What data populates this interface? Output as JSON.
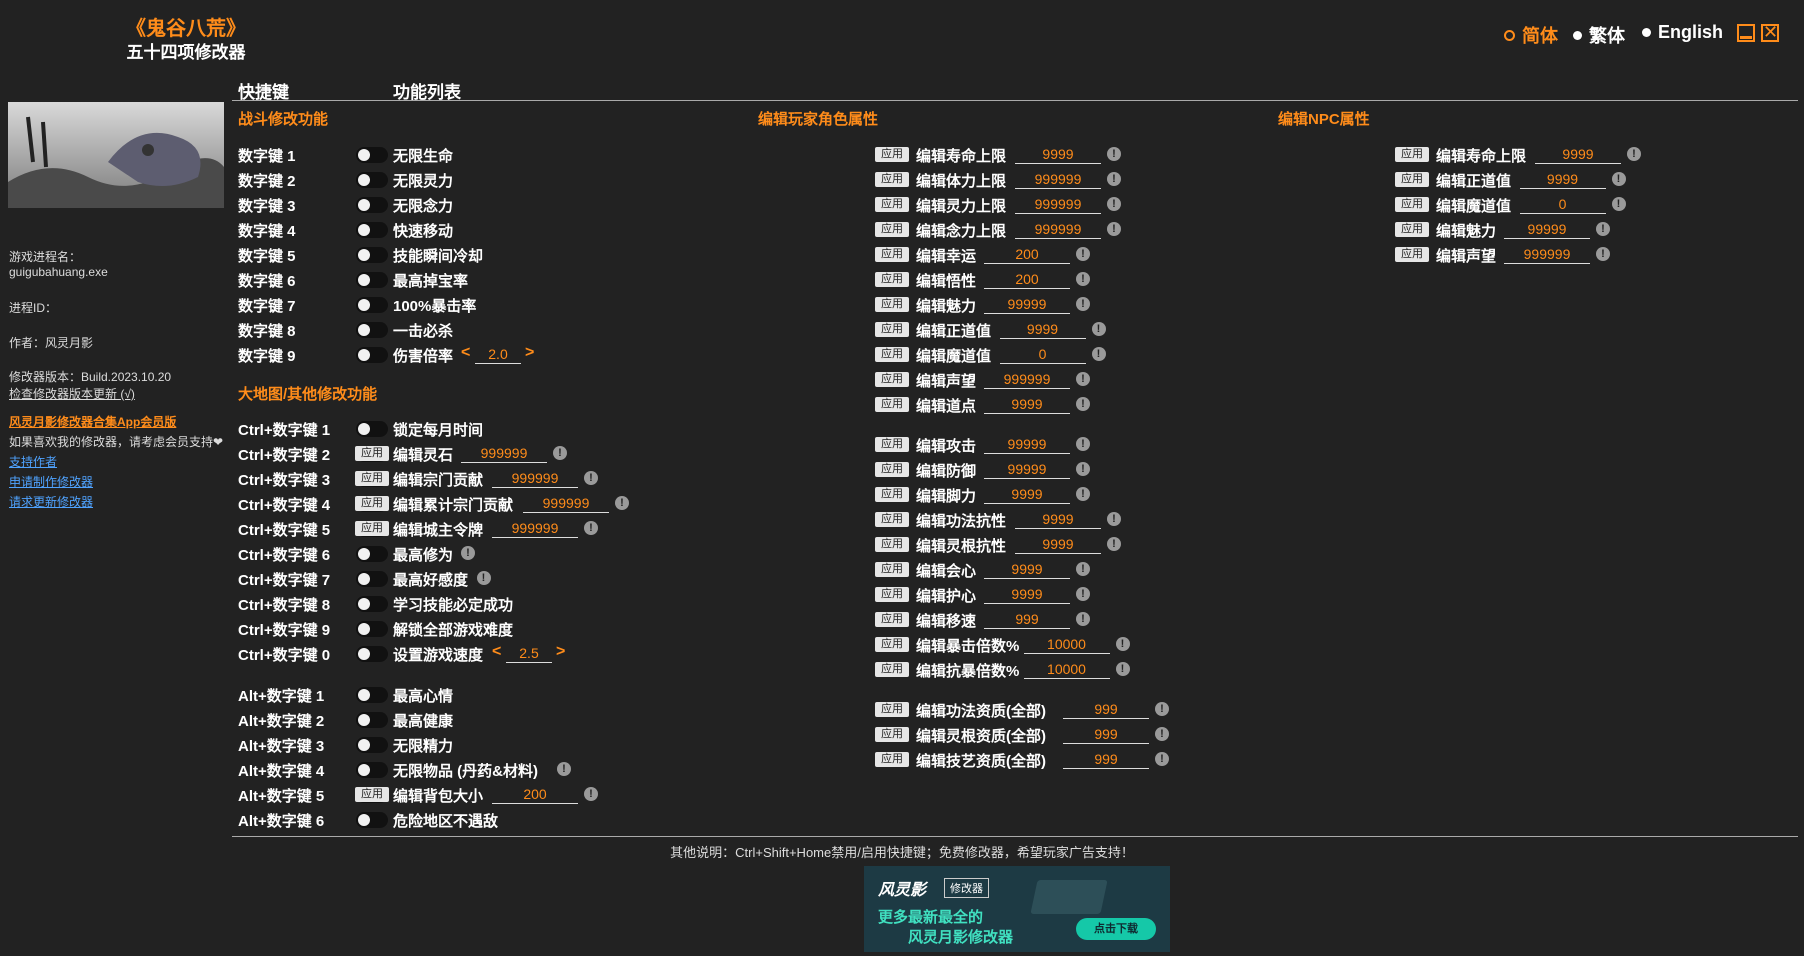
{
  "header": {
    "title": "《鬼谷八荒》",
    "subtitle": "五十四项修改器",
    "languages": [
      {
        "label": "简体",
        "active": true
      },
      {
        "label": "繁体",
        "active": false
      },
      {
        "label": "English",
        "active": false
      }
    ],
    "close_glyph": "✕"
  },
  "sidebar": {
    "process_name_label": "游戏进程名：",
    "process_name": "guigubahuang.exe",
    "pid_label": "进程ID：",
    "author": "作者：风灵月影",
    "version": "修改器版本：Build.2023.10.20",
    "check_update": "检查修改器版本更新 (√)",
    "app_link": "风灵月影修改器合集App会员版",
    "support_text": "如果喜欢我的修改器，请考虑会员支持❤",
    "links": [
      "支持作者",
      "申请制作修改器",
      "请求更新修改器"
    ]
  },
  "columns": {
    "hotkeys": "快捷键",
    "features": "功能列表"
  },
  "sections": {
    "combat": "战斗修改功能",
    "player": "编辑玩家角色属性",
    "npc": "编辑NPC属性",
    "map": "大地图/其他修改功能"
  },
  "apply_label": "应用",
  "info_glyph": "!",
  "arrow_left": "<",
  "arrow_right": ">",
  "combat_rows": [
    {
      "key": "数字键 1",
      "label": "无限生命"
    },
    {
      "key": "数字键 2",
      "label": "无限灵力"
    },
    {
      "key": "数字键 3",
      "label": "无限念力"
    },
    {
      "key": "数字键 4",
      "label": "快速移动"
    },
    {
      "key": "数字键 5",
      "label": "技能瞬间冷却"
    },
    {
      "key": "数字键 6",
      "label": "最高掉宝率"
    },
    {
      "key": "数字键 7",
      "label": "100%暴击率"
    },
    {
      "key": "数字键 8",
      "label": "一击必杀"
    },
    {
      "key": "数字键 9",
      "label": "伤害倍率",
      "value": "2.0"
    }
  ],
  "map_rows": [
    {
      "key": "Ctrl+数字键 1",
      "label": "锁定每月时间"
    },
    {
      "key": "Ctrl+数字键 2",
      "label": "编辑灵石",
      "value": "999999"
    },
    {
      "key": "Ctrl+数字键 3",
      "label": "编辑宗门贡献",
      "value": "999999"
    },
    {
      "key": "Ctrl+数字键 4",
      "label": "编辑累计宗门贡献",
      "value": "999999"
    },
    {
      "key": "Ctrl+数字键 5",
      "label": "编辑城主令牌",
      "value": "999999"
    },
    {
      "key": "Ctrl+数字键 6",
      "label": "最高修为"
    },
    {
      "key": "Ctrl+数字键 7",
      "label": "最高好感度"
    },
    {
      "key": "Ctrl+数字键 8",
      "label": "学习技能必定成功"
    },
    {
      "key": "Ctrl+数字键 9",
      "label": "解锁全部游戏难度"
    },
    {
      "key": "Ctrl+数字键 0",
      "label": "设置游戏速度",
      "value": "2.5"
    }
  ],
  "alt_rows": [
    {
      "key": "Alt+数字键 1",
      "label": "最高心情"
    },
    {
      "key": "Alt+数字键 2",
      "label": "最高健康"
    },
    {
      "key": "Alt+数字键 3",
      "label": "无限精力"
    },
    {
      "key": "Alt+数字键 4",
      "label": "无限物品 (丹药&材料)"
    },
    {
      "key": "Alt+数字键 5",
      "label": "编辑背包大小",
      "value": "200"
    },
    {
      "key": "Alt+数字键 6",
      "label": "危险地区不遇敌"
    }
  ],
  "player_groups": [
    [
      {
        "label": "编辑寿命上限",
        "value": "9999"
      },
      {
        "label": "编辑体力上限",
        "value": "999999"
      },
      {
        "label": "编辑灵力上限",
        "value": "999999"
      },
      {
        "label": "编辑念力上限",
        "value": "999999"
      },
      {
        "label": "编辑幸运",
        "value": "200"
      },
      {
        "label": "编辑悟性",
        "value": "200"
      },
      {
        "label": "编辑魅力",
        "value": "99999"
      },
      {
        "label": "编辑正道值",
        "value": "9999"
      },
      {
        "label": "编辑魔道值",
        "value": "0"
      },
      {
        "label": "编辑声望",
        "value": "999999"
      },
      {
        "label": "编辑道点",
        "value": "9999"
      }
    ],
    [
      {
        "label": "编辑攻击",
        "value": "99999"
      },
      {
        "label": "编辑防御",
        "value": "99999"
      },
      {
        "label": "编辑脚力",
        "value": "9999"
      },
      {
        "label": "编辑功法抗性",
        "value": "9999"
      },
      {
        "label": "编辑灵根抗性",
        "value": "9999"
      },
      {
        "label": "编辑会心",
        "value": "9999"
      },
      {
        "label": "编辑护心",
        "value": "9999"
      },
      {
        "label": "编辑移速",
        "value": "999"
      },
      {
        "label": "编辑暴击倍数%",
        "value": "10000"
      },
      {
        "label": "编辑抗暴倍数%",
        "value": "10000"
      }
    ],
    [
      {
        "label": "编辑功法资质(全部)",
        "value": "999"
      },
      {
        "label": "编辑灵根资质(全部)",
        "value": "999"
      },
      {
        "label": "编辑技艺资质(全部)",
        "value": "999"
      }
    ]
  ],
  "npc_rows": [
    {
      "label": "编辑寿命上限",
      "value": "9999"
    },
    {
      "label": "编辑正道值",
      "value": "9999"
    },
    {
      "label": "编辑魔道值",
      "value": "0"
    },
    {
      "label": "编辑魅力",
      "value": "99999"
    },
    {
      "label": "编辑声望",
      "value": "999999"
    }
  ],
  "footer": {
    "note": "其他说明：Ctrl+Shift+Home禁用/启用快捷键；免费修改器，希望玩家广告支持！",
    "banner": {
      "logo": "风灵影",
      "tag": "修改器",
      "line1": "更多最新最全的",
      "line2": "风灵月影修改器",
      "button": "点击下载"
    }
  }
}
